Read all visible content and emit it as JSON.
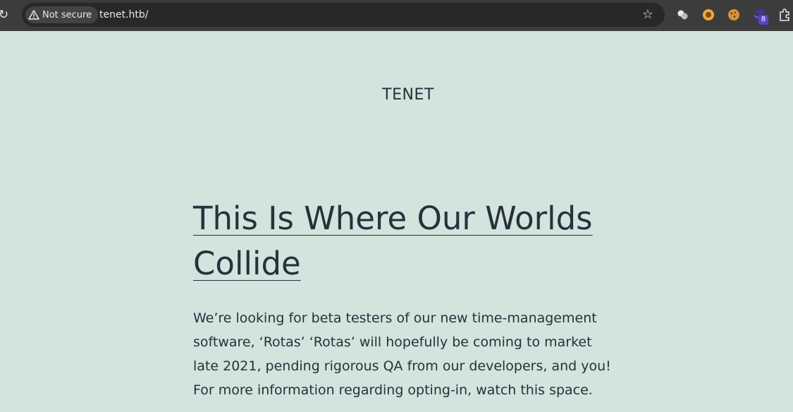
{
  "browser": {
    "security_label": "Not secure",
    "url": "tenet.htb/",
    "extension_badge": "8"
  },
  "site": {
    "title": "TENET"
  },
  "post": {
    "title": "This Is Where Our Worlds Collide",
    "body": "We’re looking for beta testers of our new time-management software, ‘Rotas’ ‘Rotas’ will hopefully be coming to market late 2021, pending rigorous QA from our developers, and you! For more information regarding opting-in, watch this space."
  },
  "colors": {
    "background": "#d1e4dd",
    "text": "#28303d",
    "toolbar": "#3c3c3c"
  }
}
